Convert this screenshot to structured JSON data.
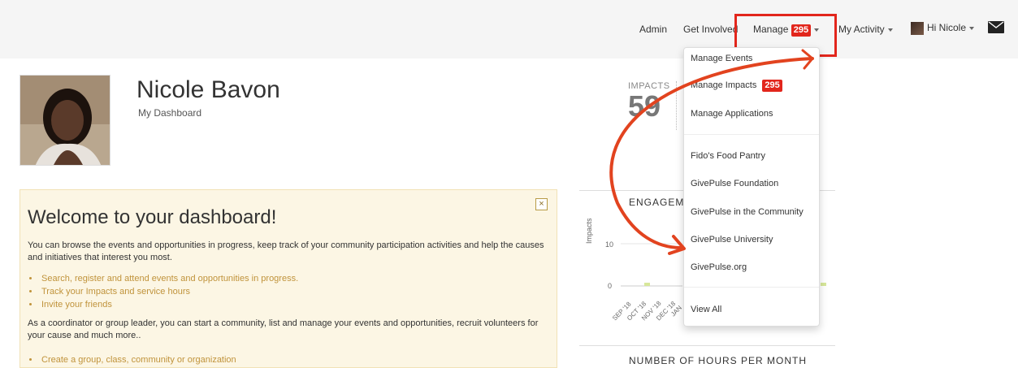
{
  "navbar": {
    "admin": "Admin",
    "get_involved": "Get Involved",
    "manage": "Manage",
    "manage_badge": "295",
    "my_activity": "My Activity",
    "greeting": "Hi Nicole"
  },
  "profile": {
    "name": "Nicole Bavon",
    "subtitle": "My Dashboard"
  },
  "impacts": {
    "label": "IMPACTS",
    "value": "59"
  },
  "welcome": {
    "title": "Welcome to your dashboard!",
    "close_label": "×",
    "intro": "You can browse the events and opportunities in progress, keep track of your community participation activities and help the causes and initiatives that interest you most.",
    "links": [
      "Search, register and attend events and opportunities in progress.",
      "Track your Impacts and service hours",
      "Invite your friends"
    ],
    "leader_text": "As a coordinator or group leader, you can start a community, list and manage your events and opportunities, recruit volunteers for your cause and much more..",
    "leader_link": "Create a group, class, community or organization"
  },
  "engagement": {
    "title": "ENGAGEM",
    "ylabel": "Impacts",
    "yticks": [
      "10",
      "0"
    ],
    "xticks": [
      "SEP '18",
      "OCT '18",
      "NOV '18",
      "DEC '18",
      "JAN"
    ]
  },
  "hours": {
    "title": "NUMBER OF HOURS PER MONTH"
  },
  "dropdown": {
    "items": [
      {
        "label": "Manage Events"
      },
      {
        "label": "Manage Impacts",
        "badge": "295"
      },
      {
        "label": "Manage Applications"
      },
      {
        "label": "Fido's Food Pantry"
      },
      {
        "label": "GivePulse Foundation"
      },
      {
        "label": "GivePulse in the Community"
      },
      {
        "label": "GivePulse University"
      },
      {
        "label": "GivePulse.org"
      },
      {
        "label": "View All"
      }
    ]
  },
  "colors": {
    "accent_red": "#e2261c",
    "link_gold": "#c0933b",
    "welcome_bg": "#fcf6e4"
  }
}
